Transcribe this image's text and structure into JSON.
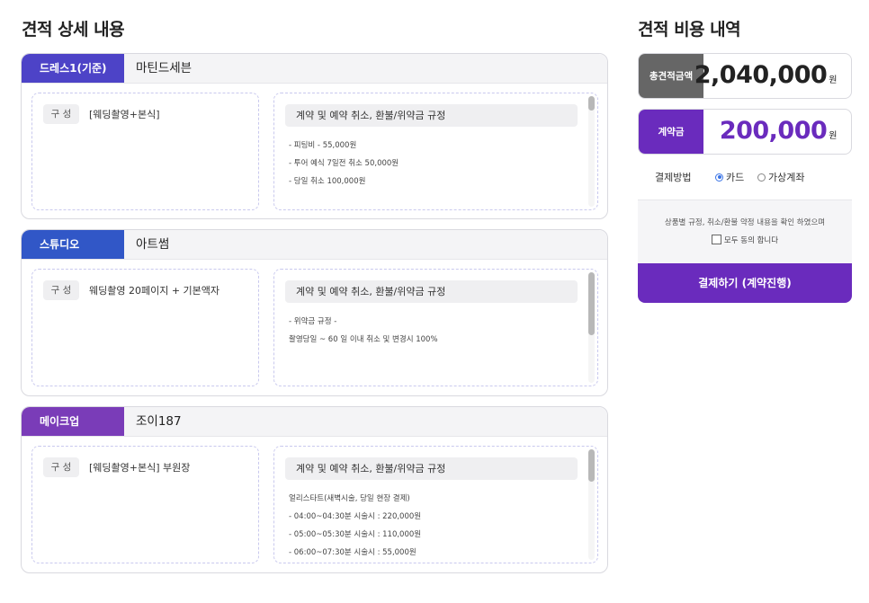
{
  "left_title": "견적 상세 내용",
  "right_title": "견적 비용 내역",
  "composition_label": "구 성",
  "cards": [
    {
      "tag": "드레스1(기준)",
      "tag_color": "#4d43c7",
      "vendor": "마틴드세븐",
      "composition": "[웨딩촬영+본식]",
      "policy_title": "계약 및 예약 취소, 환불/위약금 규정",
      "policy_lines": [
        "- 피팅비 - 55,000원",
        "- 투어 예식 7일전 취소 50,000원",
        "- 당일 취소 100,000원"
      ]
    },
    {
      "tag": "스튜디오",
      "tag_color": "#3157c7",
      "vendor": "아트썸",
      "composition": "웨딩촬영 20페이지 + 기본액자",
      "policy_title": "계약 및 예약 취소, 환불/위약금 규정",
      "policy_lines": [
        "- 위약금 규정 -",
        "촬영당일 ~ 60 일 이내 취소 및 변경시 100%"
      ]
    },
    {
      "tag": "메이크업",
      "tag_color": "#7a3cb8",
      "vendor": "조이187",
      "composition": "[웨딩촬영+본식] 부원장",
      "policy_title": "계약 및 예약 취소, 환불/위약금 규정",
      "policy_lines": [
        "얼리스타트(새벽시술, 당일 현장 결제)",
        "- 04:00~04:30분 시술시 : 220,000원",
        "- 05:00~05:30분 시술시 : 110,000원",
        "- 06:00~07:30분 시술시 : 55,000원"
      ]
    }
  ],
  "summary": {
    "total_label": "총견적금액",
    "total_value": "2,040,000",
    "total_unit": "원",
    "total_label_color": "#666666",
    "total_value_color": "#222222",
    "deposit_label": "계약금",
    "deposit_value": "200,000",
    "deposit_unit": "원",
    "deposit_label_color": "#6a2bbd",
    "deposit_value_color": "#6a2bbd"
  },
  "payment": {
    "label": "결제방법",
    "options": [
      {
        "label": "카드",
        "selected": true
      },
      {
        "label": "가상계좌",
        "selected": false
      }
    ]
  },
  "agreement": {
    "notice": "상품별 규정, 취소/환불 약정 내용을 확인 하였으며",
    "checkbox_label": "모두 동의 합니다"
  },
  "pay_button": "결제하기 (계약진행)"
}
